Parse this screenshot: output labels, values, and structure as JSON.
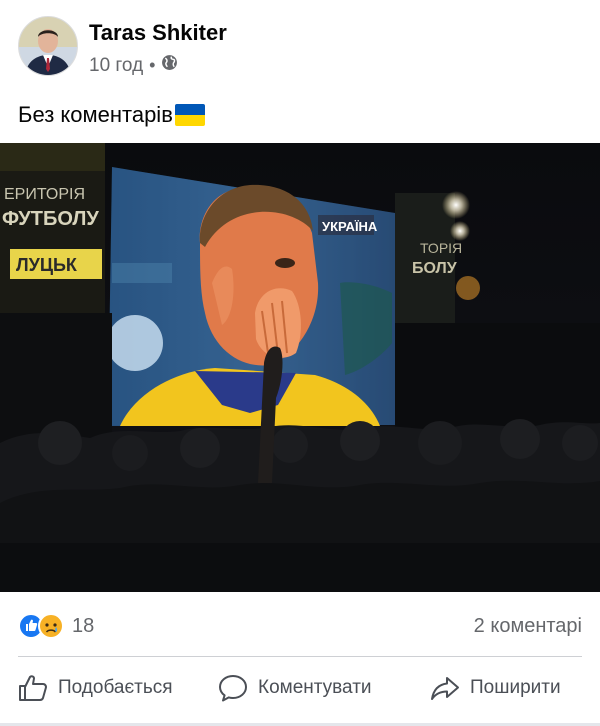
{
  "post": {
    "author": "Taras Shkiter",
    "time": "10 год",
    "separator": "•",
    "privacy_icon": "globe-icon",
    "text": "Без коментарів",
    "text_emoji": "ukraine-flag",
    "photo_screen_text": "УКРАЇНА",
    "photo_banner_left": [
      "ЕРИТОРІЯ",
      "ФУТБОЛУ",
      "ЛУЦЬК"
    ],
    "photo_banner_right": [
      "ТОРІЯ",
      "БОЛУ"
    ]
  },
  "reactions": {
    "icons": [
      "like-reaction-icon",
      "sad-reaction-icon"
    ],
    "count": "18",
    "comments": "2 коментарі"
  },
  "actions": {
    "like": "Подобається",
    "comment": "Коментувати",
    "share": "Поширити"
  },
  "colors": {
    "flag_blue": "#0057b7",
    "flag_yellow": "#ffd700",
    "like_blue": "#1877f2",
    "text_secondary": "#65676b"
  }
}
